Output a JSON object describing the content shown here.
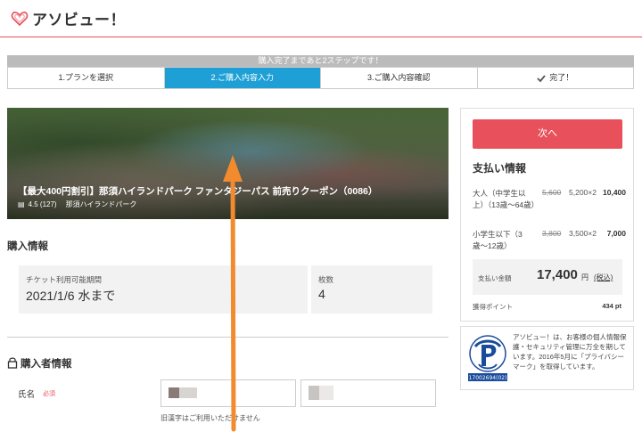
{
  "header": {
    "logo_text": "アソビュー！"
  },
  "steps": {
    "banner": "購入完了まであと2ステップです！",
    "items": [
      "1.プランを選択",
      "2.ご購入内容入力",
      "3.ご購入内容確認",
      "完了！"
    ]
  },
  "hero": {
    "title": "【最大400円割引】那須ハイランドパーク ファンタジーパス 前売りクーポン（0086）",
    "rating": "4.5 (127)",
    "location": "那須ハイランドパーク"
  },
  "purchase_info": {
    "title": "購入情報",
    "period_label": "チケット利用可能期間",
    "period_value": "2021/1/6 水まで",
    "count_label": "枚数",
    "count_value": "4"
  },
  "buyer_info": {
    "title": "購入者情報",
    "name_label": "氏名",
    "required": "必須",
    "hint": "旧漢字はご利用いただけません"
  },
  "payment": {
    "next_label": "次へ",
    "title": "支払い情報",
    "rows": [
      {
        "label": "大人（中学生以上）（13歳〜64歳）",
        "original": "5,600",
        "calc": "5,200×2",
        "total": "10,400"
      },
      {
        "label": "小学生以下（3歳〜12歳）",
        "original": "3,800",
        "calc": "3,500×2",
        "total": "7,000"
      }
    ],
    "total_label": "支払い金額",
    "total_value": "17,400",
    "yen": "円",
    "tax": "(税込)",
    "points_label": "獲得ポイント",
    "points_value": "434 pt"
  },
  "privacy": {
    "text": "アソビュー！は、お客様の個人情報保護・セキュリティ管理に万全を期しています。2016年5月に「プライバシーマーク」を取得しています。",
    "mark_text": "プライバシー",
    "mark_number": "17002694(02)"
  },
  "colors": {
    "accent": "#e8505b",
    "step_active": "#1ea0d6",
    "annotation": "#f28a2e"
  }
}
